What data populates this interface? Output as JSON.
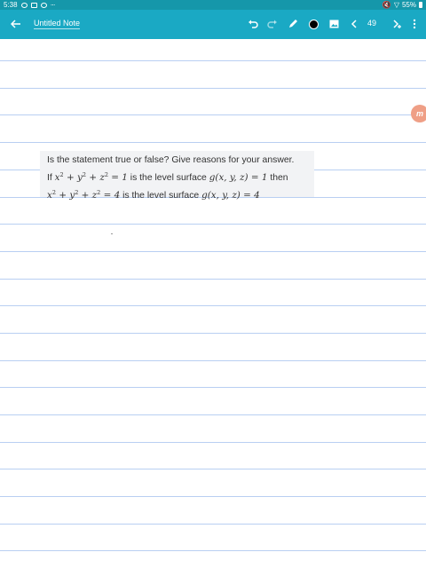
{
  "status_bar": {
    "time": "5:38",
    "dots": "···",
    "battery": "55%"
  },
  "toolbar": {
    "title": "Untitled Note",
    "page_number": "49",
    "pen_color": "#000000",
    "accent": "#1aa9c4"
  },
  "question": {
    "line1": "Is the statement true or false? Give reasons for your answer.",
    "line2_prefix": "If",
    "eq1": "x² + y² + z² = 1",
    "line2_middle": "is the level surface",
    "g1": "g(x, y, z) = 1",
    "line2_suffix": "then",
    "eq2": "x² + y² + z² = 4",
    "line3_middle": "is the level surface",
    "g2": "g(x, y, z) = 4"
  },
  "floating_badge": {
    "label": "m"
  }
}
